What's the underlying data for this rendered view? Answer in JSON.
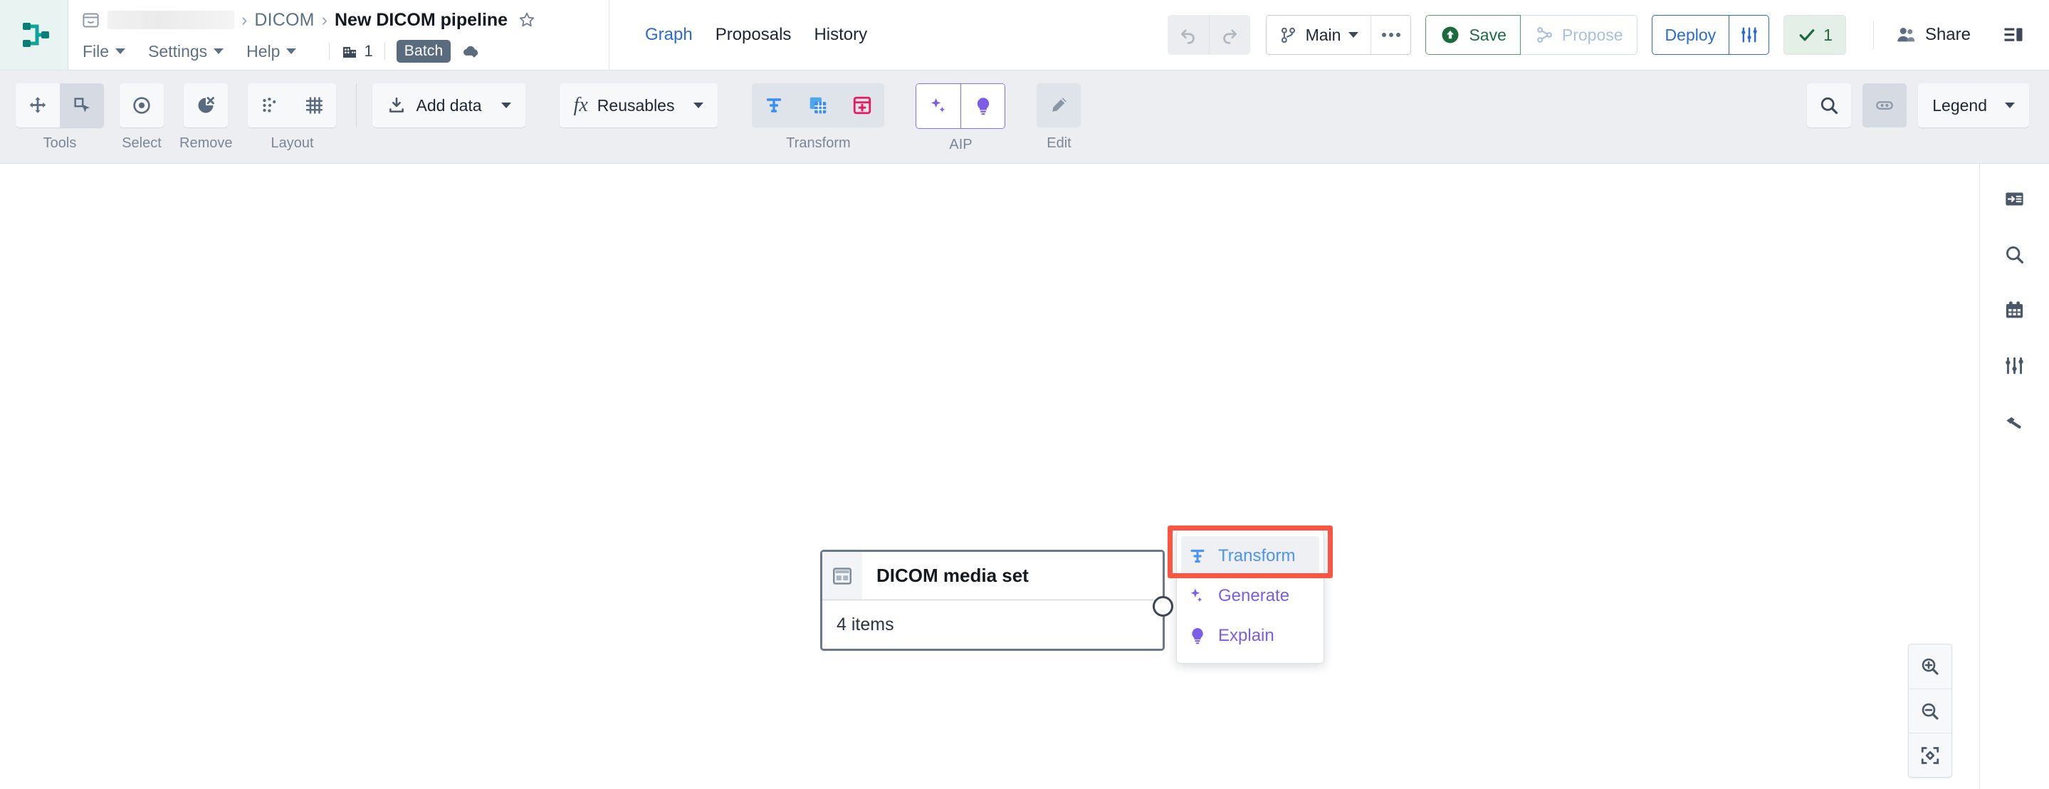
{
  "app": {
    "logo_icon": "pipeline-logo-icon",
    "accent_blue": "#2a6ad4",
    "accent_teal": "#0fa39a",
    "highlight_red": "#fb5540",
    "purple": "#7c5ce8"
  },
  "breadcrumb": {
    "folder_icon": "folder-icon",
    "redacted_label": "",
    "separator": "›",
    "items": [
      {
        "label": "DICOM"
      }
    ],
    "current": "New DICOM pipeline",
    "star_icon": "star-outline-icon"
  },
  "menubar": {
    "items": [
      {
        "label": "File",
        "icon": "chevron-down-icon"
      },
      {
        "label": "Settings",
        "icon": "chevron-down-icon"
      },
      {
        "label": "Help",
        "icon": "chevron-down-icon"
      }
    ],
    "build_icon": "building-icon",
    "build_count": "1",
    "batch_badge": "Batch",
    "cloud_icon": "cloud-check-icon"
  },
  "tabs": [
    {
      "label": "Graph",
      "active": true
    },
    {
      "label": "Proposals",
      "active": false
    },
    {
      "label": "History",
      "active": false
    }
  ],
  "top_actions": {
    "undo_icon": "undo-icon",
    "redo_icon": "redo-icon",
    "branch_icon": "git-branch-icon",
    "branch_label": "Main",
    "branch_caret_icon": "chevron-down-icon",
    "more_icon": "ellipsis-icon",
    "save_icon": "save-upload-icon",
    "save_label": "Save",
    "propose_icon": "propose-branch-icon",
    "propose_label": "Propose",
    "deploy_label": "Deploy",
    "deploy_icon": "sliders-icon",
    "check_icon": "check-icon",
    "check_count": "1",
    "share_icon": "people-icon",
    "share_label": "Share",
    "panel_toggle_icon": "panel-layout-icon"
  },
  "toolbar": {
    "groups": [
      {
        "name": "tools",
        "label": "Tools",
        "buttons": [
          {
            "icon": "move-arrows-icon",
            "active": false
          },
          {
            "icon": "marquee-select-cursor-icon",
            "active": true
          }
        ]
      },
      {
        "name": "select",
        "label": "Select",
        "buttons": [
          {
            "icon": "target-circle-icon",
            "active": false
          }
        ]
      },
      {
        "name": "remove",
        "label": "Remove",
        "buttons": [
          {
            "icon": "remove-node-icon",
            "active": false
          }
        ]
      },
      {
        "name": "layout",
        "label": "Layout",
        "buttons": [
          {
            "icon": "scatter-dots-icon",
            "active": false
          },
          {
            "icon": "grid-icon",
            "active": false
          }
        ]
      }
    ],
    "add_data": {
      "icon": "download-icon",
      "label": "Add data",
      "caret_icon": "chevron-down-icon"
    },
    "reusables": {
      "icon": "fx-icon",
      "label": "Reusables",
      "caret_icon": "chevron-down-icon"
    },
    "transform_group": {
      "label": "Transform",
      "buttons": [
        {
          "icon": "transform-node-icon"
        },
        {
          "icon": "duplicate-table-icon"
        },
        {
          "icon": "add-column-icon"
        }
      ]
    },
    "aip_group": {
      "label": "AIP",
      "buttons": [
        {
          "icon": "sparkles-icon"
        },
        {
          "icon": "lightbulb-icon"
        }
      ]
    },
    "edit_group": {
      "label": "Edit",
      "buttons": [
        {
          "icon": "pencil-icon"
        }
      ]
    },
    "right": {
      "search_icon": "search-icon",
      "toggle_icon": "pill-toggle-icon",
      "legend_label": "Legend",
      "legend_caret_icon": "chevron-down-icon"
    }
  },
  "canvas": {
    "node": {
      "icon": "dataset-table-icon",
      "title": "DICOM media set",
      "subtitle": "4 items",
      "output_port": "output-port-handle"
    },
    "context_menu": {
      "items": [
        {
          "label": "Transform",
          "icon": "transform-node-icon",
          "state": "highlighted"
        },
        {
          "label": "Generate",
          "icon": "sparkles-icon",
          "state": "normal"
        },
        {
          "label": "Explain",
          "icon": "lightbulb-icon",
          "state": "normal"
        }
      ]
    },
    "zoom_controls": [
      {
        "icon": "zoom-in-icon"
      },
      {
        "icon": "zoom-out-icon"
      },
      {
        "icon": "fit-to-screen-icon"
      }
    ]
  },
  "right_rail": {
    "items": [
      {
        "icon": "input-panel-icon"
      },
      {
        "icon": "search-icon"
      },
      {
        "icon": "calendar-icon"
      },
      {
        "icon": "sliders-icon"
      },
      {
        "icon": "hammer-icon"
      }
    ]
  }
}
